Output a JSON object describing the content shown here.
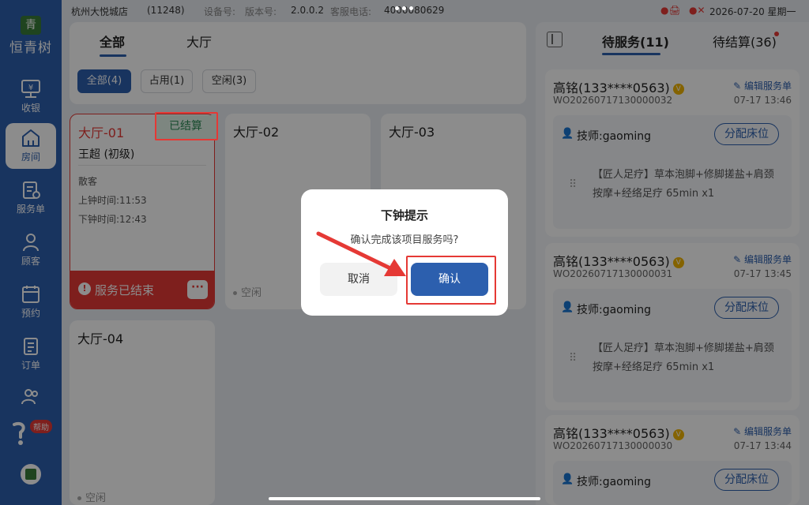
{
  "sidebar": {
    "logo_mark": "青",
    "logo_text": "恒青树",
    "items": [
      {
        "label": "收银",
        "icon": "cashier-icon"
      },
      {
        "label": "房间",
        "icon": "house-icon"
      },
      {
        "label": "服务单",
        "icon": "service-order-icon"
      },
      {
        "label": "顾客",
        "icon": "customer-icon"
      },
      {
        "label": "预约",
        "icon": "calendar-icon"
      },
      {
        "label": "订单",
        "icon": "order-icon"
      }
    ],
    "help_badge": "帮助",
    "active_index": 1
  },
  "topbar": {
    "store": "杭州大悦城店",
    "store_id": "(11248)",
    "device_label": "设备号:",
    "version_label": "版本号:",
    "version": "2.0.0.2",
    "service_phone_label": "客服电话:",
    "service_phone": "4000080629",
    "datetime": "2026-07-20 星期一"
  },
  "main": {
    "tabs": [
      "全部",
      "大厅"
    ],
    "filters": [
      {
        "label": "全部(4)",
        "active": true
      },
      {
        "label": "占用(1)",
        "active": false
      },
      {
        "label": "空闲(3)",
        "active": false
      }
    ],
    "rooms": [
      {
        "name": "大厅-01",
        "badge": "已结算",
        "staff": "王超 (初级)",
        "customer": "散客",
        "start_time": "上钟时间:11:53",
        "end_time": "下钟时间:12:43",
        "status_bar": "服务已结束",
        "more": "···"
      },
      {
        "name": "大厅-02",
        "status": "空闲"
      },
      {
        "name": "大厅-03",
        "status": ""
      },
      {
        "name": "大厅-04",
        "status": "空闲"
      }
    ]
  },
  "right_panel": {
    "tabs": [
      "待服务(11)",
      "待结算(36)"
    ],
    "orders": [
      {
        "customer": "高铭(133****0563)",
        "edit_label": "编辑服务单",
        "order_no": "WO20260717130000032",
        "time": "07-17 13:46",
        "technician": "技师:gaoming",
        "assign_label": "分配床位",
        "service": "【匠人足疗】草本泡脚+修脚搓盐+肩颈按摩+经络足疗 65min x1"
      },
      {
        "customer": "高铭(133****0563)",
        "edit_label": "编辑服务单",
        "order_no": "WO20260717130000031",
        "time": "07-17 13:45",
        "technician": "技师:gaoming",
        "assign_label": "分配床位",
        "service": "【匠人足疗】草本泡脚+修脚搓盐+肩颈按摩+经络足疗 65min x1"
      },
      {
        "customer": "高铭(133****0563)",
        "edit_label": "编辑服务单",
        "order_no": "WO20260717130000030",
        "time": "07-17 13:44",
        "technician": "技师:gaoming",
        "assign_label": "分配床位"
      }
    ]
  },
  "dialog": {
    "title": "下钟提示",
    "message": "确认完成该项目服务吗?",
    "cancel_label": "取消",
    "confirm_label": "确认"
  },
  "colors": {
    "primary": "#2c5fae",
    "danger": "#e53935",
    "settled": "#2e8b57",
    "sidebar": "#2c5fae"
  }
}
